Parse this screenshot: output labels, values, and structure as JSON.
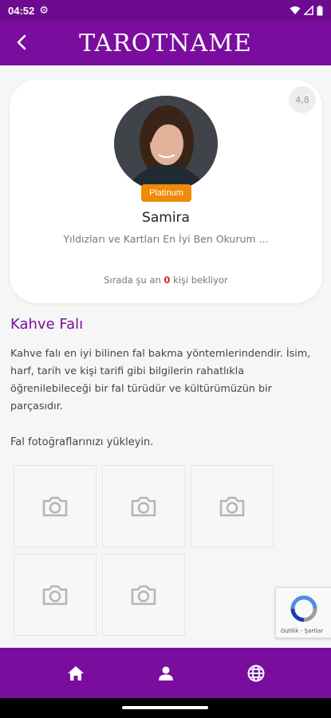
{
  "status": {
    "time": "04:52"
  },
  "app": {
    "title": "TAROTNAME"
  },
  "profile": {
    "rating": "4,8",
    "badge": "Platinum",
    "name": "Samira",
    "tagline": "Yıldızları ve Kartları En İyi Ben Okurum ...",
    "queue_prefix": "Sırada şu an",
    "queue_count": "0",
    "queue_suffix": "kişi bekliyor"
  },
  "section": {
    "title": "Kahve Falı",
    "description": "Kahve falı en iyi bilinen fal bakma yöntemlerindendir. İsim, harf, tarih ve kişi tarifi gibi bilgilerin rahatlıkla öğrenilebileceği bir fal türüdür ve kültürümüzün bir parçasıdır.",
    "upload_label": "Fal fotoğraflarınızı yükleyin."
  },
  "recaptcha": {
    "footer": "Gizlilik - Şartlar"
  },
  "colors": {
    "primary": "#7a0d9e",
    "badge": "#f08a08",
    "queue_count": "#e01d1d"
  },
  "icons": {
    "status": [
      "settings-icon",
      "wifi-icon",
      "signal-icon",
      "battery-icon"
    ],
    "photo_slot": "camera-icon",
    "nav": [
      "home-icon",
      "user-icon",
      "globe-icon"
    ]
  }
}
